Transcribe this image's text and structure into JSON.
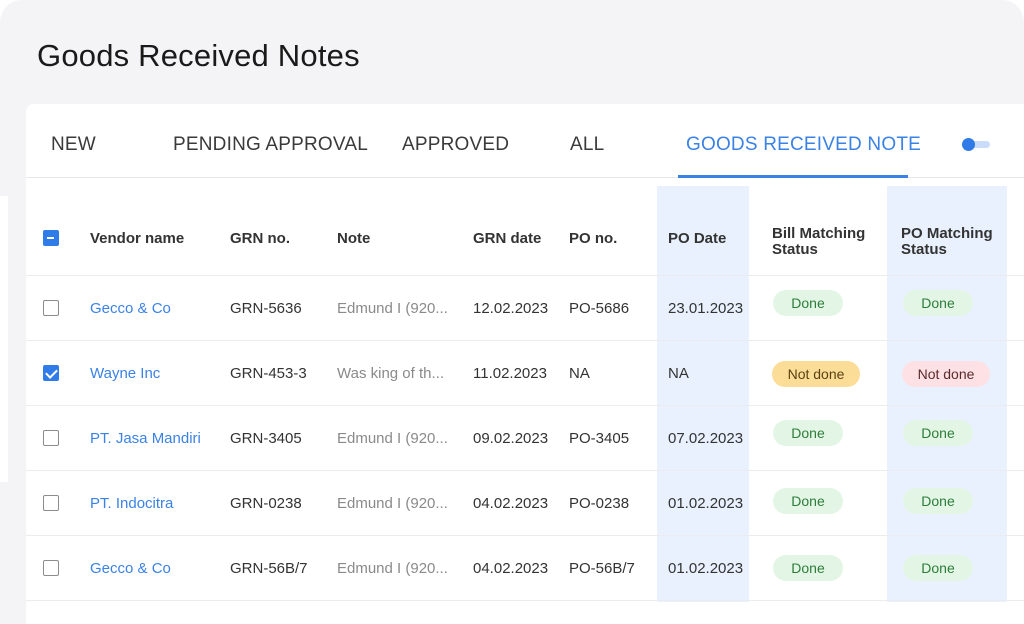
{
  "page": {
    "title": "Goods Received Notes"
  },
  "tabs": [
    {
      "label": "NEW"
    },
    {
      "label": "PENDING APPROVAL"
    },
    {
      "label": "APPROVED"
    },
    {
      "label": "ALL"
    },
    {
      "label": "GOODS RECEIVED NOTE"
    }
  ],
  "colors": {
    "accent": "#3b82e6",
    "done_bg": "#e3f6e6",
    "pending_bg": "#fbdd98",
    "failed_bg": "#fde1e4",
    "highlight_col": "#e8f1fd"
  },
  "table": {
    "headers": {
      "vendor": "Vendor name",
      "grn": "GRN no.",
      "note": "Note",
      "grn_date": "GRN date",
      "po": "PO no.",
      "po_date": "PO Date",
      "bill_line1": "Bill Matching",
      "bill_line2": "Status",
      "pom_line1": "PO Matching",
      "pom_line2": "Status"
    },
    "rows": [
      {
        "vendor": "Gecco & Co",
        "grn": "GRN-5636",
        "note": "Edmund I (920...",
        "grn_date": "12.02.2023",
        "po": "PO-5686",
        "po_date": "23.01.2023",
        "bill": "Done",
        "pom": "Done"
      },
      {
        "vendor": "Wayne Inc",
        "grn": "GRN-453-3",
        "note": "Was king of th...",
        "grn_date": "11.02.2023",
        "po": "NA",
        "po_date": "NA",
        "bill": "Not done",
        "pom": "Not done"
      },
      {
        "vendor": "PT. Jasa Mandiri",
        "grn": "GRN-3405",
        "note": "Edmund I (920...",
        "grn_date": "09.02.2023",
        "po": "PO-3405",
        "po_date": "07.02.2023",
        "bill": "Done",
        "pom": "Done"
      },
      {
        "vendor": "PT. Indocitra",
        "grn": "GRN-0238",
        "note": "Edmund I (920...",
        "grn_date": "04.02.2023",
        "po": "PO-0238",
        "po_date": "01.02.2023",
        "bill": "Done",
        "pom": "Done"
      },
      {
        "vendor": "Gecco & Co",
        "grn": "GRN-56B/7",
        "note": "Edmund I (920...",
        "grn_date": "04.02.2023",
        "po": "PO-56B/7",
        "po_date": "01.02.2023",
        "bill": "Done",
        "pom": "Done"
      }
    ]
  }
}
